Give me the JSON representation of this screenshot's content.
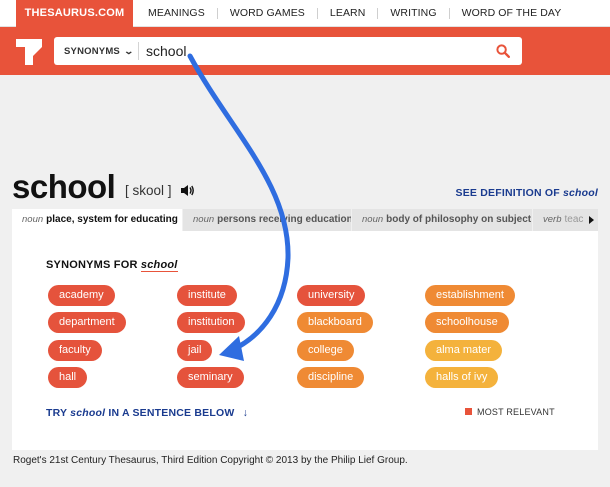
{
  "brand": "THESAURUS.COM",
  "nav": [
    "MEANINGS",
    "WORD GAMES",
    "LEARN",
    "WRITING",
    "WORD OF THE DAY"
  ],
  "search": {
    "mode_label": "SYNONYMS",
    "query": "school",
    "icon": "search-icon"
  },
  "entry": {
    "word": "school",
    "pronunciation": "[ skool ]",
    "see_definition_prefix": "SEE DEFINITION OF",
    "see_definition_word": "school"
  },
  "tabs": [
    {
      "pos": "noun",
      "def": "place, system for educating",
      "active": true
    },
    {
      "pos": "noun",
      "def": "persons receiving education",
      "active": false
    },
    {
      "pos": "noun",
      "def": "body of philosophy on subject",
      "active": false
    },
    {
      "pos": "verb",
      "def": "teach",
      "active": false
    }
  ],
  "synonyms_heading_prefix": "SYNONYMS FOR",
  "synonyms_heading_word": "school",
  "synonyms": [
    {
      "word": "academy",
      "color": "#e5533c"
    },
    {
      "word": "department",
      "color": "#e5533c"
    },
    {
      "word": "faculty",
      "color": "#e5533c"
    },
    {
      "word": "hall",
      "color": "#e5533c"
    },
    {
      "word": "institute",
      "color": "#e5533c"
    },
    {
      "word": "institution",
      "color": "#e5533c"
    },
    {
      "word": "jail",
      "color": "#e5533c"
    },
    {
      "word": "seminary",
      "color": "#e5533c"
    },
    {
      "word": "university",
      "color": "#e5533c"
    },
    {
      "word": "blackboard",
      "color": "#ef8a34"
    },
    {
      "word": "college",
      "color": "#ef8a34"
    },
    {
      "word": "discipline",
      "color": "#ef8a34"
    },
    {
      "word": "establishment",
      "color": "#ef8a34"
    },
    {
      "word": "schoolhouse",
      "color": "#ef8a34"
    },
    {
      "word": "alma mater",
      "color": "#f4b23c"
    },
    {
      "word": "halls of ivy",
      "color": "#f4b23c"
    }
  ],
  "try_prefix": "TRY",
  "try_word": "school",
  "try_suffix": "IN A SENTENCE BELOW",
  "try_arrow": "↓",
  "legend_label": "MOST RELEVANT",
  "colors": {
    "brand": "#e8533a",
    "link": "#1a3b8f",
    "overlay_arrow": "#2f6de0"
  },
  "copyright": "Roget's 21st Century Thesaurus, Third Edition Copyright © 2013 by the Philip Lief Group."
}
